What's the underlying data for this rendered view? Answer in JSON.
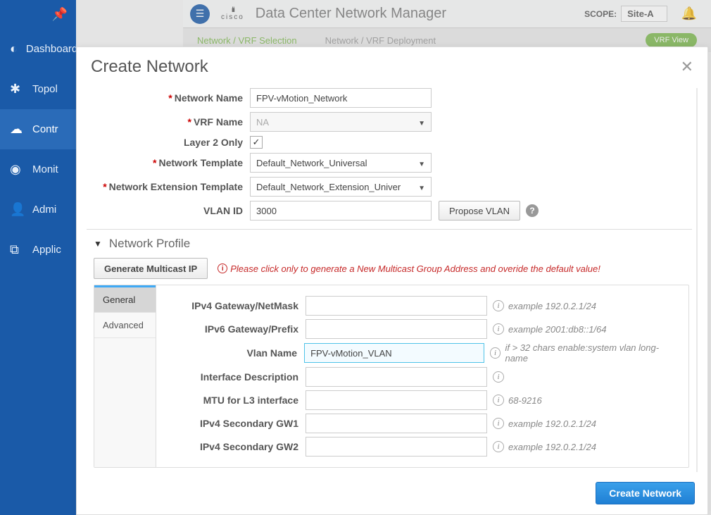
{
  "topbar": {
    "app_title": "Data Center Network Manager",
    "scope_label": "SCOPE:",
    "scope_value": "Site-A",
    "logo_text": "cisco"
  },
  "breadcrumb": {
    "step1": "Network / VRF Selection",
    "step2": "Network / VRF Deployment",
    "vrf_view": "VRF View"
  },
  "sidebar": {
    "items": [
      {
        "label": "Dashboard"
      },
      {
        "label": "Topol"
      },
      {
        "label": "Contr"
      },
      {
        "label": "Monit"
      },
      {
        "label": "Admi"
      },
      {
        "label": "Applic"
      }
    ]
  },
  "modal": {
    "title": "Create Network",
    "labels": {
      "network_name": "Network Name",
      "vrf_name": "VRF Name",
      "layer2": "Layer 2 Only",
      "net_template": "Network Template",
      "net_ext_template": "Network Extension Template",
      "vlan_id": "VLAN ID"
    },
    "values": {
      "network_name": "FPV-vMotion_Network",
      "vrf_name": "NA",
      "net_template": "Default_Network_Universal",
      "net_ext_template": "Default_Network_Extension_Univer",
      "vlan_id": "3000"
    },
    "propose_vlan_btn": "Propose VLAN",
    "section_title": "Network Profile",
    "gen_btn": "Generate Multicast IP",
    "gen_hint": "Please click only to generate a New Multicast Group Address and overide the default value!",
    "tabs": {
      "general": "General",
      "advanced": "Advanced"
    },
    "profile": {
      "labels": {
        "ipv4_gw": "IPv4 Gateway/NetMask",
        "ipv6_gw": "IPv6 Gateway/Prefix",
        "vlan_name": "Vlan Name",
        "iface_desc": "Interface Description",
        "mtu": "MTU for L3 interface",
        "sec_gw1": "IPv4 Secondary GW1",
        "sec_gw2": "IPv4 Secondary GW2"
      },
      "values": {
        "ipv4_gw": "",
        "ipv6_gw": "",
        "vlan_name": "FPV-vMotion_VLAN",
        "iface_desc": "",
        "mtu": "",
        "sec_gw1": "",
        "sec_gw2": ""
      },
      "hints": {
        "ipv4_gw": "example 192.0.2.1/24",
        "ipv6_gw": "example 2001:db8::1/64",
        "vlan_name": "if > 32 chars enable:system vlan long-name",
        "iface_desc": "",
        "mtu": "68-9216",
        "sec_gw1": "example 192.0.2.1/24",
        "sec_gw2": "example 192.0.2.1/24"
      }
    },
    "create_btn": "Create Network"
  }
}
